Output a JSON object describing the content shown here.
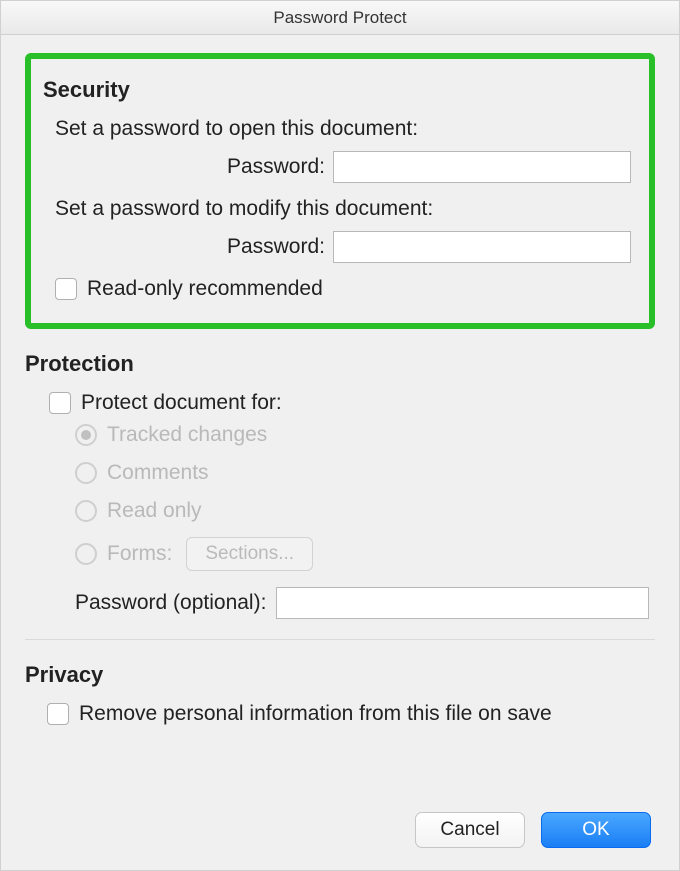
{
  "titlebar": {
    "title": "Password Protect"
  },
  "security": {
    "heading": "Security",
    "open_desc": "Set a password to open this document:",
    "open_label": "Password:",
    "open_value": "",
    "modify_desc": "Set a password to modify this document:",
    "modify_label": "Password:",
    "modify_value": "",
    "readonly_label": "Read-only recommended"
  },
  "protection": {
    "heading": "Protection",
    "protect_for_label": "Protect document for:",
    "radios": {
      "tracked": "Tracked changes",
      "comments": "Comments",
      "readonly": "Read only",
      "forms": "Forms:"
    },
    "sections_button": "Sections...",
    "optional_label": "Password (optional):",
    "optional_value": ""
  },
  "privacy": {
    "heading": "Privacy",
    "remove_label": "Remove personal information from this file on save"
  },
  "buttons": {
    "cancel": "Cancel",
    "ok": "OK"
  }
}
